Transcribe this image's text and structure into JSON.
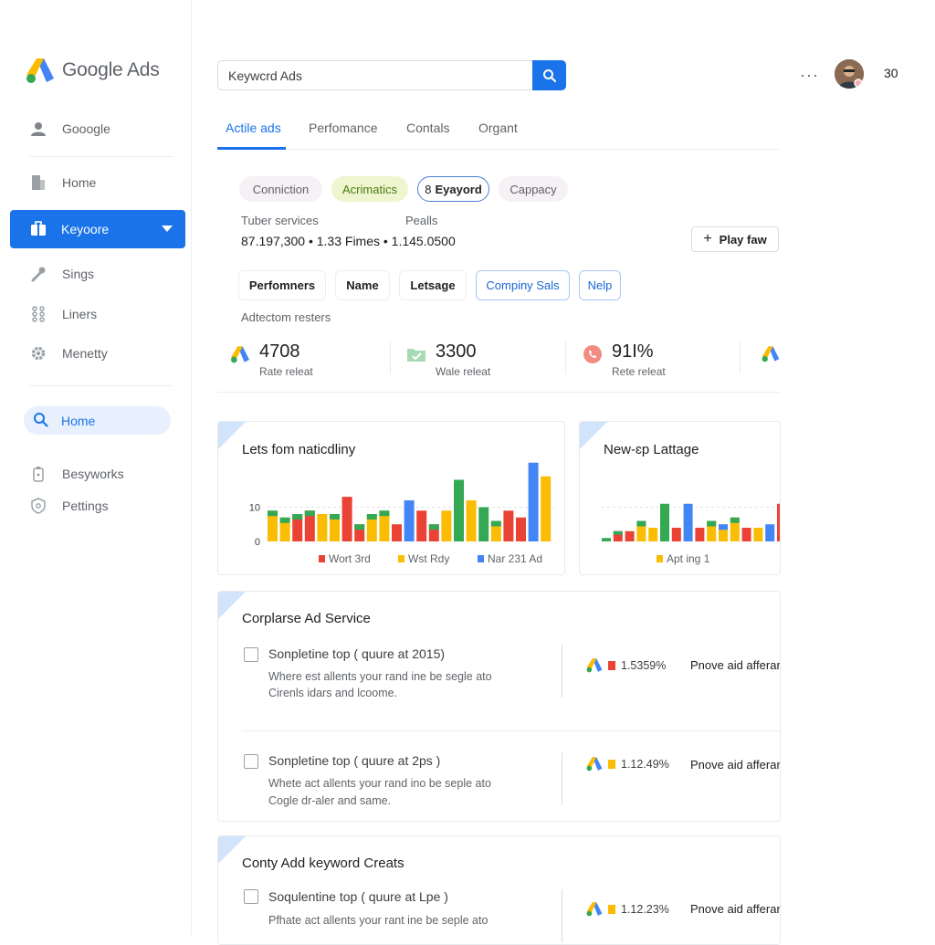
{
  "app": {
    "title": "Google Ads"
  },
  "sidebar": {
    "items": [
      {
        "label": "Gooogle",
        "icon": "person-icon"
      },
      {
        "label": "Home",
        "icon": "document-icon"
      },
      {
        "label": "Keyoore",
        "icon": "briefcase-icon",
        "active": true
      },
      {
        "label": "Sings",
        "icon": "wrench-icon"
      },
      {
        "label": "Liners",
        "icon": "grid-dots-icon"
      },
      {
        "label": "Menetty",
        "icon": "gear-icon"
      },
      {
        "label": "Home",
        "icon": "search-icon",
        "pill": true
      },
      {
        "label": "Besyworks",
        "icon": "lock-icon"
      },
      {
        "label": "Pettings",
        "icon": "shield-icon"
      }
    ]
  },
  "search": {
    "value": "Keywcrd Ads"
  },
  "header": {
    "more": "···",
    "count": "30"
  },
  "tabs": [
    "Actile ads",
    "Perfomance",
    "Contals",
    "Organt"
  ],
  "chips": [
    "Conniction",
    "Acrimatics",
    "Eyayord",
    "Cappacy"
  ],
  "summary": {
    "label1": "Tuber services",
    "label2": "Pealls",
    "values": "87.197,300 • 1.33 Fimes • 1.145.0500",
    "button": "Play faw"
  },
  "filters": [
    "Perfomners",
    "Name",
    "Letsage",
    "Compiny Sals",
    "Nelp"
  ],
  "section_label": "Adtectom resters",
  "stats": [
    {
      "value": "4708",
      "sub": "Rate releat"
    },
    {
      "value": "3300",
      "sub": "Wale releat"
    },
    {
      "value": "91I%",
      "sub": "Rete releat"
    }
  ],
  "colors": {
    "blue": "#4285f4",
    "red": "#ea4335",
    "yellow": "#fbbc04",
    "green": "#34a853",
    "accent": "#1a73e8"
  },
  "chart_data": [
    {
      "type": "bar",
      "title": "Lets fom naticdliny",
      "ytick_labels": [
        "10",
        "0"
      ],
      "legend": [
        "Wort 3rd",
        "Wst Rdy",
        "Nar 231 Ad"
      ],
      "legend_colors": [
        "#ea4335",
        "#fbbc04",
        "#4285f4"
      ],
      "ylim": [
        0,
        24
      ],
      "values": [
        {
          "v": 9,
          "c": "#fbbc04",
          "cap": "#34a853"
        },
        {
          "v": 7,
          "c": "#fbbc04",
          "cap": "#34a853"
        },
        {
          "v": 8,
          "c": "#ea4335",
          "cap": "#34a853"
        },
        {
          "v": 9,
          "c": "#ea4335",
          "cap": "#34a853"
        },
        {
          "v": 8,
          "c": "#fbbc04"
        },
        {
          "v": 8,
          "c": "#fbbc04",
          "cap": "#34a853"
        },
        {
          "v": 13,
          "c": "#ea4335",
          "cap": "#ea4335"
        },
        {
          "v": 5,
          "c": "#ea4335",
          "cap": "#34a853"
        },
        {
          "v": 8,
          "c": "#fbbc04",
          "cap": "#34a853"
        },
        {
          "v": 9,
          "c": "#fbbc04",
          "cap": "#34a853"
        },
        {
          "v": 5,
          "c": "#ea4335"
        },
        {
          "v": 12,
          "c": "#4285f4"
        },
        {
          "v": 9,
          "c": "#ea4335"
        },
        {
          "v": 5,
          "c": "#ea4335",
          "cap": "#34a853"
        },
        {
          "v": 9,
          "c": "#fbbc04"
        },
        {
          "v": 18,
          "c": "#34a853"
        },
        {
          "v": 12,
          "c": "#fbbc04"
        },
        {
          "v": 10,
          "c": "#34a853"
        },
        {
          "v": 6,
          "c": "#fbbc04",
          "cap": "#34a853"
        },
        {
          "v": 9,
          "c": "#ea4335"
        },
        {
          "v": 7,
          "c": "#ea4335"
        },
        {
          "v": 23,
          "c": "#4285f4"
        },
        {
          "v": 19,
          "c": "#fbbc04"
        }
      ]
    },
    {
      "type": "bar",
      "title": "New-ɛp Lattage",
      "legend": [
        "Apt ing 1"
      ],
      "legend_colors": [
        "#fbbc04"
      ],
      "ylim": [
        0,
        24
      ],
      "values": [
        {
          "v": 1,
          "c": "#34a853"
        },
        {
          "v": 3,
          "c": "#ea4335",
          "cap": "#34a853"
        },
        {
          "v": 3,
          "c": "#ea4335"
        },
        {
          "v": 6,
          "c": "#fbbc04",
          "cap": "#34a853"
        },
        {
          "v": 4,
          "c": "#fbbc04"
        },
        {
          "v": 11,
          "c": "#34a853"
        },
        {
          "v": 4,
          "c": "#ea4335"
        },
        {
          "v": 11,
          "c": "#4285f4"
        },
        {
          "v": 4,
          "c": "#ea4335"
        },
        {
          "v": 6,
          "c": "#fbbc04",
          "cap": "#34a853"
        },
        {
          "v": 5,
          "c": "#fbbc04",
          "cap": "#4285f4"
        },
        {
          "v": 7,
          "c": "#fbbc04",
          "cap": "#34a853"
        },
        {
          "v": 4,
          "c": "#ea4335"
        },
        {
          "v": 4,
          "c": "#fbbc04"
        },
        {
          "v": 5,
          "c": "#4285f4"
        },
        {
          "v": 11,
          "c": "#ea4335"
        }
      ]
    }
  ],
  "cards": [
    {
      "title": "Corplarse Ad Service",
      "items": [
        {
          "title": "Sonpletine top ( quure at 2015)",
          "desc1": "Where est allents your rand ine be segle ato",
          "desc2": "Cirenls idars and lcoome.",
          "metric": "1.5359%",
          "metric_color": "#ea4335",
          "note": "Pnove aid afferar"
        },
        {
          "title": "Sonpletine top ( quure at 2ps )",
          "desc1": "Whete act allents your rand ino be seple ato",
          "desc2": "Cogle dr-aler and same.",
          "metric": "1.12.49%",
          "metric_color": "#fbbc04",
          "note": "Pnove aid afferar"
        }
      ]
    },
    {
      "title": "Conty Add keyword Creats",
      "items": [
        {
          "title": "Soqulentine top ( quure at Lpe )",
          "desc1": "Pfhate act allents your rant ine be seple ato",
          "desc2": "",
          "metric": "1.12.23%",
          "metric_color": "#fbbc04",
          "note": "Pnove aid afferar"
        }
      ]
    }
  ]
}
